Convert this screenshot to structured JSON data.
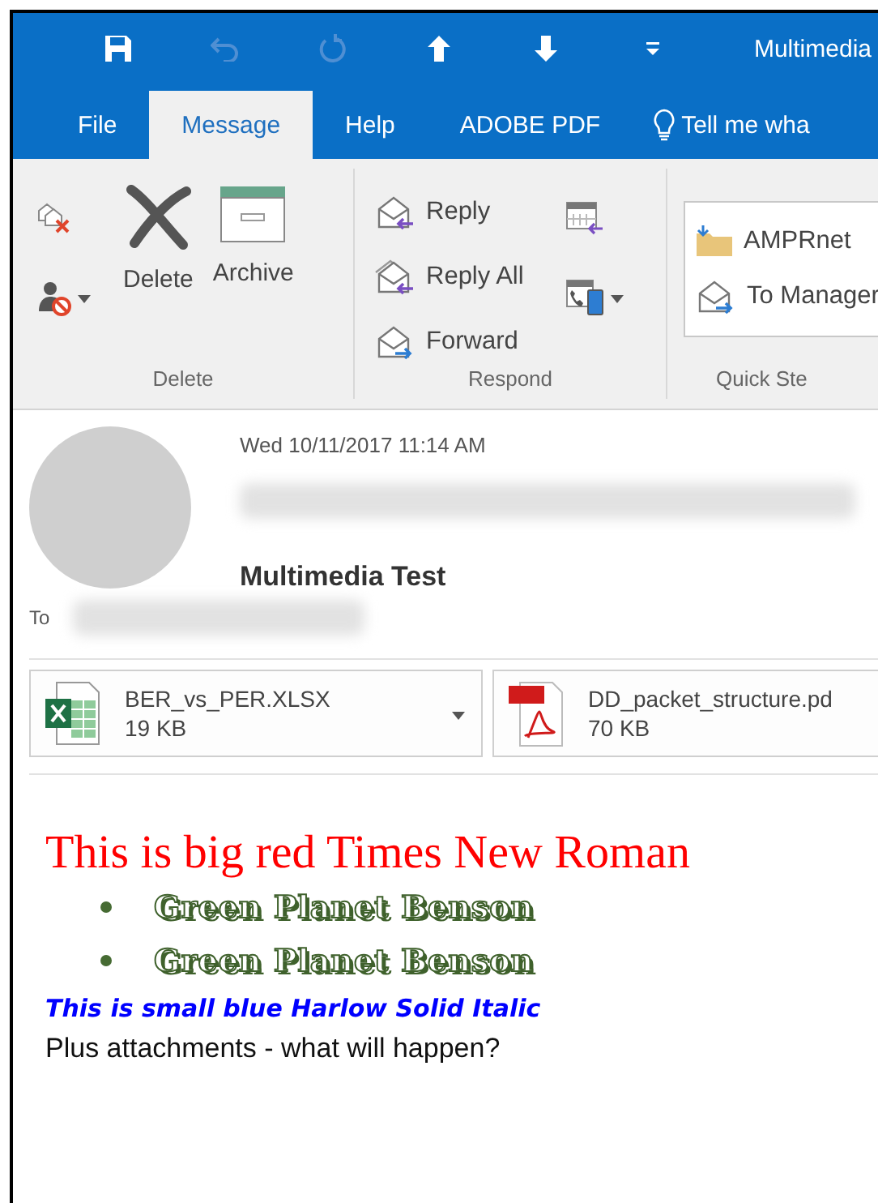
{
  "quick_access": [
    {
      "kind": "save",
      "disabled": false
    },
    {
      "kind": "undo",
      "disabled": true
    },
    {
      "kind": "redo",
      "disabled": true
    },
    {
      "kind": "up",
      "disabled": false
    },
    {
      "kind": "down",
      "disabled": false
    },
    {
      "kind": "customize",
      "disabled": false
    }
  ],
  "window": {
    "title": "Multimedia"
  },
  "tabs": [
    {
      "label": "File",
      "selected": false
    },
    {
      "label": "Message",
      "selected": true
    },
    {
      "label": "Help",
      "selected": false
    },
    {
      "label": "ADOBE PDF",
      "selected": false
    }
  ],
  "tell_me": {
    "label": "Tell me wha"
  },
  "delete_group": {
    "label": "Delete",
    "buttons": [
      {
        "kind": "delete",
        "label": "Delete"
      },
      {
        "kind": "archive",
        "label": "Archive"
      }
    ]
  },
  "respond_group": {
    "label": "Respond",
    "buttons": [
      {
        "kind": "reply",
        "label": "Reply"
      },
      {
        "kind": "reply_all",
        "label": "Reply All"
      },
      {
        "kind": "forward",
        "label": "Forward"
      }
    ]
  },
  "quick_steps": {
    "label": "Quick Ste",
    "steps": [
      {
        "kind": "folder",
        "label": "AMPRnet"
      },
      {
        "kind": "forward",
        "label": "To Manager"
      }
    ]
  },
  "message": {
    "date": "Wed 10/11/2017 11:14 AM",
    "subject": "Multimedia Test",
    "to_label": "To"
  },
  "attachments": [
    {
      "kind": "xlsx",
      "name": "BER_vs_PER.XLSX",
      "size": "19 KB"
    },
    {
      "kind": "pdf",
      "name": "DD_packet_structure.pd",
      "size": "70 KB"
    }
  ],
  "body": {
    "heading": "This is big red Times New Roman",
    "bullets": [
      "Green Planet Benson",
      "Green Planet Benson"
    ],
    "italic_line": "This is small blue Harlow Solid Italic",
    "plain_line": "Plus attachments - what will happen?"
  }
}
